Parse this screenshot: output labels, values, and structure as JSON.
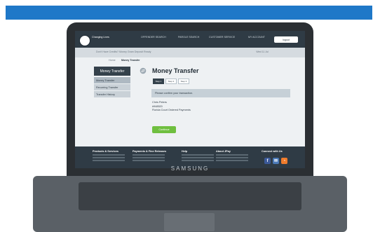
{
  "colors": {
    "top_blue": "#1f78c8",
    "nav_bg": "#2f3b45",
    "continue_green": "#6fbf3f",
    "facebook_blue": "#3b5998",
    "email_blue": "#4b79b7",
    "rss_orange": "#f07c2c"
  },
  "laptop": {
    "brand": "SAMSUNG"
  },
  "site": {
    "logo_text": "JPay",
    "nav": {
      "changing_lives": "Changing Lives",
      "items": [
        "OFFENDER SEARCH",
        "PAROLE SEARCH",
        "CUSTOMER SERVICE",
        "MY ACCOUNT"
      ],
      "signout": "logout"
    },
    "subnav": {
      "crumb": "Don't Have Credits? Money Gram Deposit Ready",
      "right": "Wed 11 Jul"
    },
    "tabs": [
      "Home",
      "Money Transfer"
    ],
    "sidebar": {
      "title": "Money Transfer",
      "items": [
        "Money Transfer",
        "Recurring Transfer",
        "Transfer History"
      ]
    },
    "main": {
      "title": "Money Transfer",
      "steps": [
        "Step 1",
        "Step 2",
        "Step 3"
      ],
      "notice": "Please confirm your transaction.",
      "info_lines": [
        "Chris Peters",
        "#948520",
        "Florida Court Ordered Payments"
      ],
      "continue_label": "Continue"
    },
    "footer": {
      "cols": [
        "Products & Services",
        "Payments & Fine Releases",
        "Help",
        "About JPay",
        "Connect with Us"
      ]
    },
    "social_icons": [
      "facebook-icon",
      "email-icon",
      "rss-icon"
    ]
  }
}
